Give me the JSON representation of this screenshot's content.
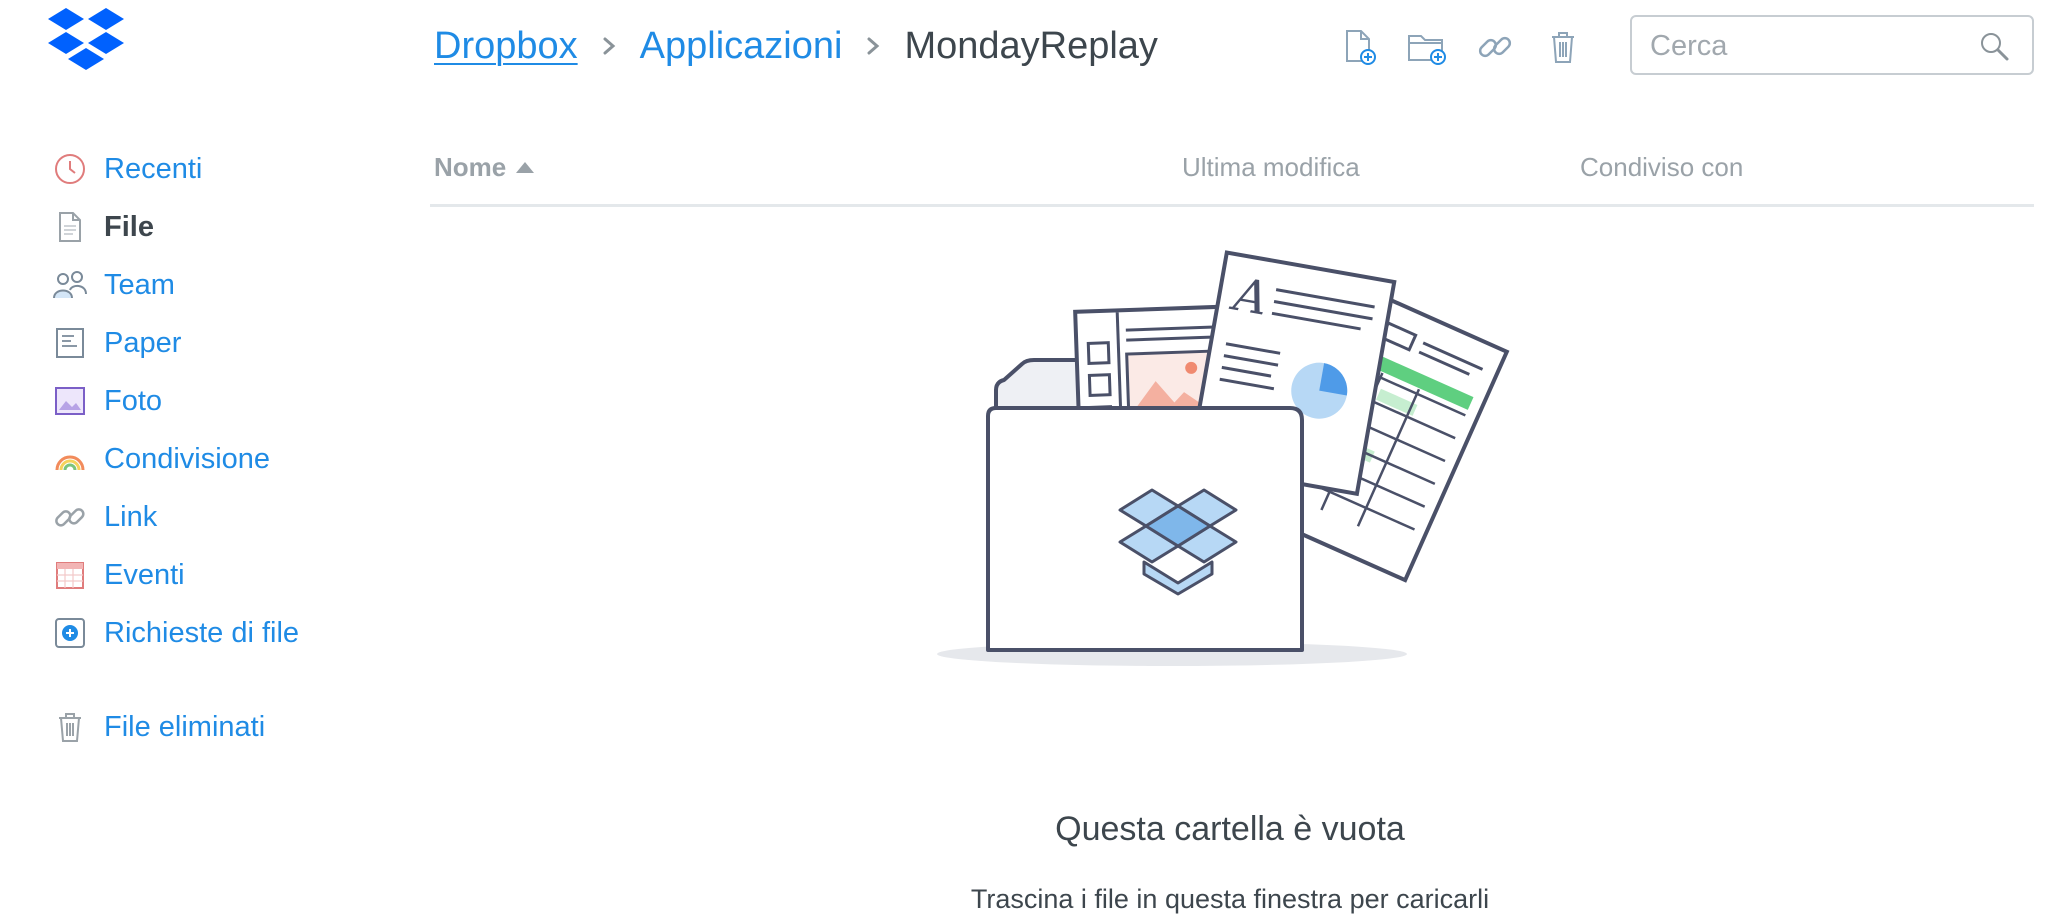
{
  "breadcrumb": {
    "root": "Dropbox",
    "parent": "Applicazioni",
    "current": "MondayReplay"
  },
  "toolbar": {
    "icons": [
      "new-file-icon",
      "new-folder-icon",
      "link-icon",
      "trash-icon"
    ]
  },
  "search": {
    "placeholder": "Cerca"
  },
  "sidebar": {
    "items": [
      {
        "label": "Recenti",
        "icon": "clock-icon"
      },
      {
        "label": "File",
        "icon": "file-icon",
        "active": true
      },
      {
        "label": "Team",
        "icon": "team-icon"
      },
      {
        "label": "Paper",
        "icon": "paper-icon"
      },
      {
        "label": "Foto",
        "icon": "photo-icon"
      },
      {
        "label": "Condivisione",
        "icon": "rainbow-icon"
      },
      {
        "label": "Link",
        "icon": "link-icon"
      },
      {
        "label": "Eventi",
        "icon": "calendar-icon"
      },
      {
        "label": "Richieste di file",
        "icon": "file-request-icon"
      }
    ],
    "deleted": {
      "label": "File eliminati",
      "icon": "trash-icon"
    }
  },
  "table": {
    "col_name": "Nome",
    "col_modified": "Ultima modifica",
    "col_shared": "Condiviso con"
  },
  "empty": {
    "title": "Questa cartella è vuota",
    "subtitle": "Trascina i file in questa finestra per caricarli"
  },
  "colors": {
    "accent": "#1f8be5",
    "text": "#3d464d",
    "muted": "#9aa2a8"
  }
}
